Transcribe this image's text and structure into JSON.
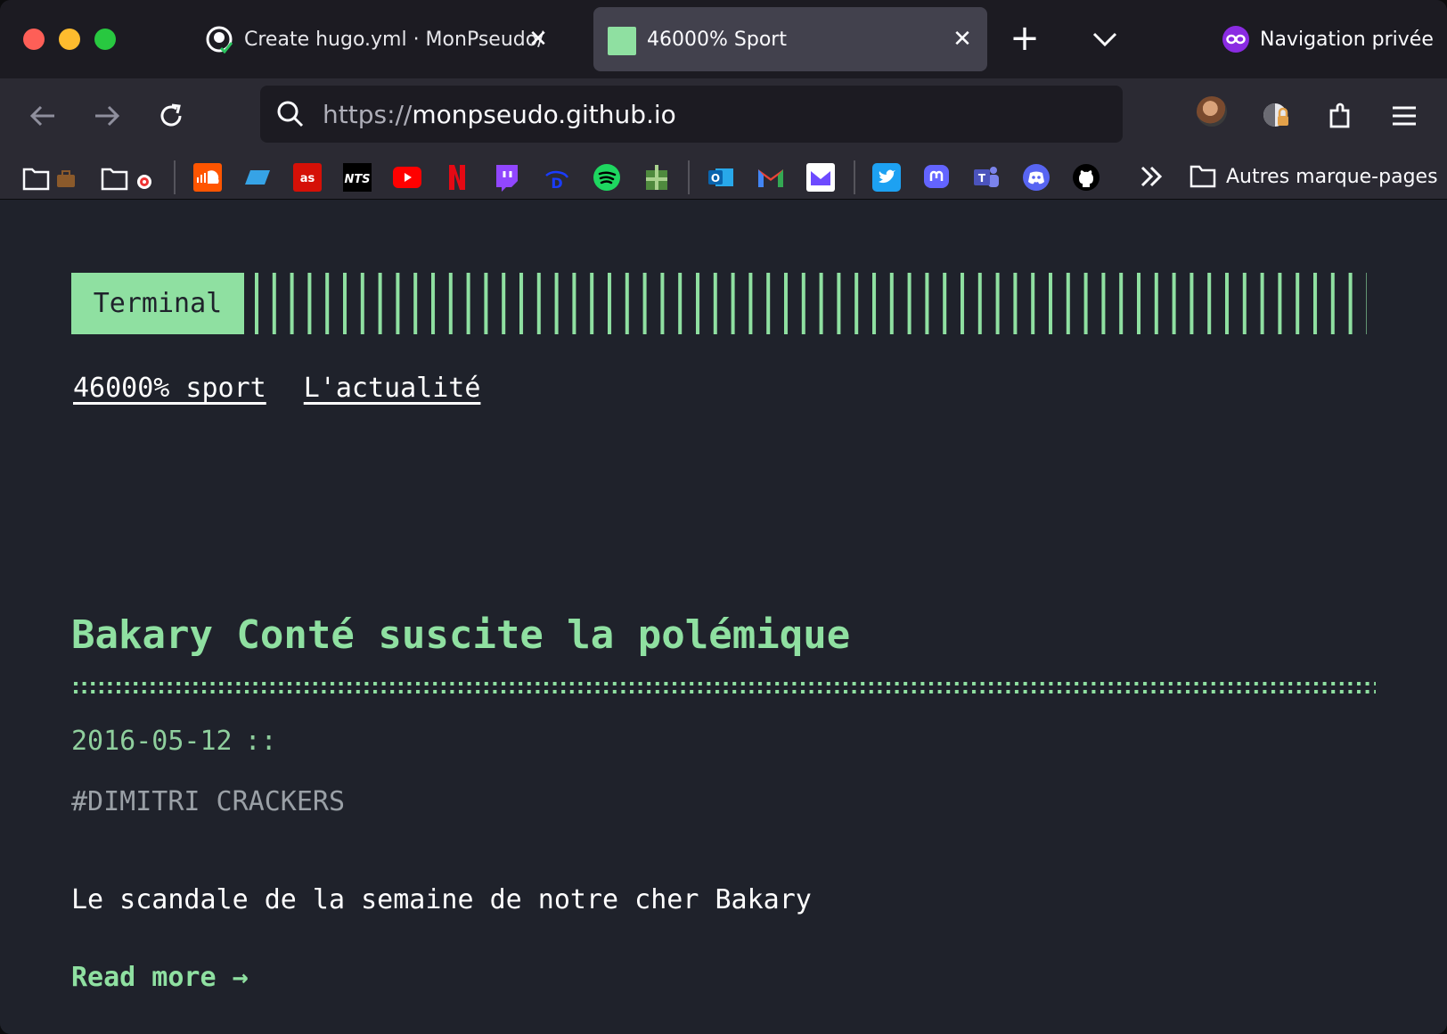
{
  "browser": {
    "tabs": [
      {
        "title": "Create hugo.yml · MonPseudo/MonPseudo.github.io",
        "favicon": "github-icon",
        "active": false
      },
      {
        "title": "46000% Sport",
        "favicon": "green-square-icon",
        "active": true
      }
    ],
    "private_label": "Navigation privée",
    "url_scheme": "https://",
    "url_host": "monpseudo.github.io",
    "bookmarks_other_label": "Autres marque-pages"
  },
  "site": {
    "logo": "Terminal",
    "menu": [
      "46000% sport",
      "L'actualité"
    ],
    "accent_color": "#8fe0a1",
    "background_color": "#1f222b"
  },
  "post": {
    "title": "Bakary Conté suscite la polémique",
    "date": "2016-05-12",
    "date_separator": "::",
    "tag": "#DIMITRI CRACKERS",
    "summary": "Le scandale de la semaine de notre cher Bakary",
    "read_more": "Read more →"
  }
}
